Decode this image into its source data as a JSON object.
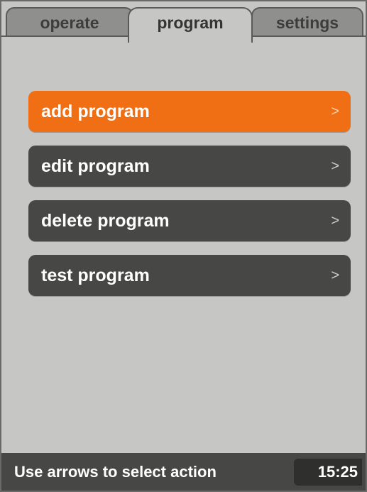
{
  "tabs": [
    {
      "label": "operate",
      "active": false
    },
    {
      "label": "program",
      "active": true
    },
    {
      "label": "settings",
      "active": false
    }
  ],
  "menu": {
    "items": [
      {
        "label": "add program",
        "chevron": ">",
        "selected": true
      },
      {
        "label": "edit program",
        "chevron": ">",
        "selected": false
      },
      {
        "label": "delete program",
        "chevron": ">",
        "selected": false
      },
      {
        "label": "test program",
        "chevron": ">",
        "selected": false
      }
    ]
  },
  "status": {
    "message": "Use arrows to select action",
    "time": "15:25"
  },
  "colors": {
    "accent": "#f06f15",
    "button": "#474846",
    "background": "#c6c7c4"
  }
}
